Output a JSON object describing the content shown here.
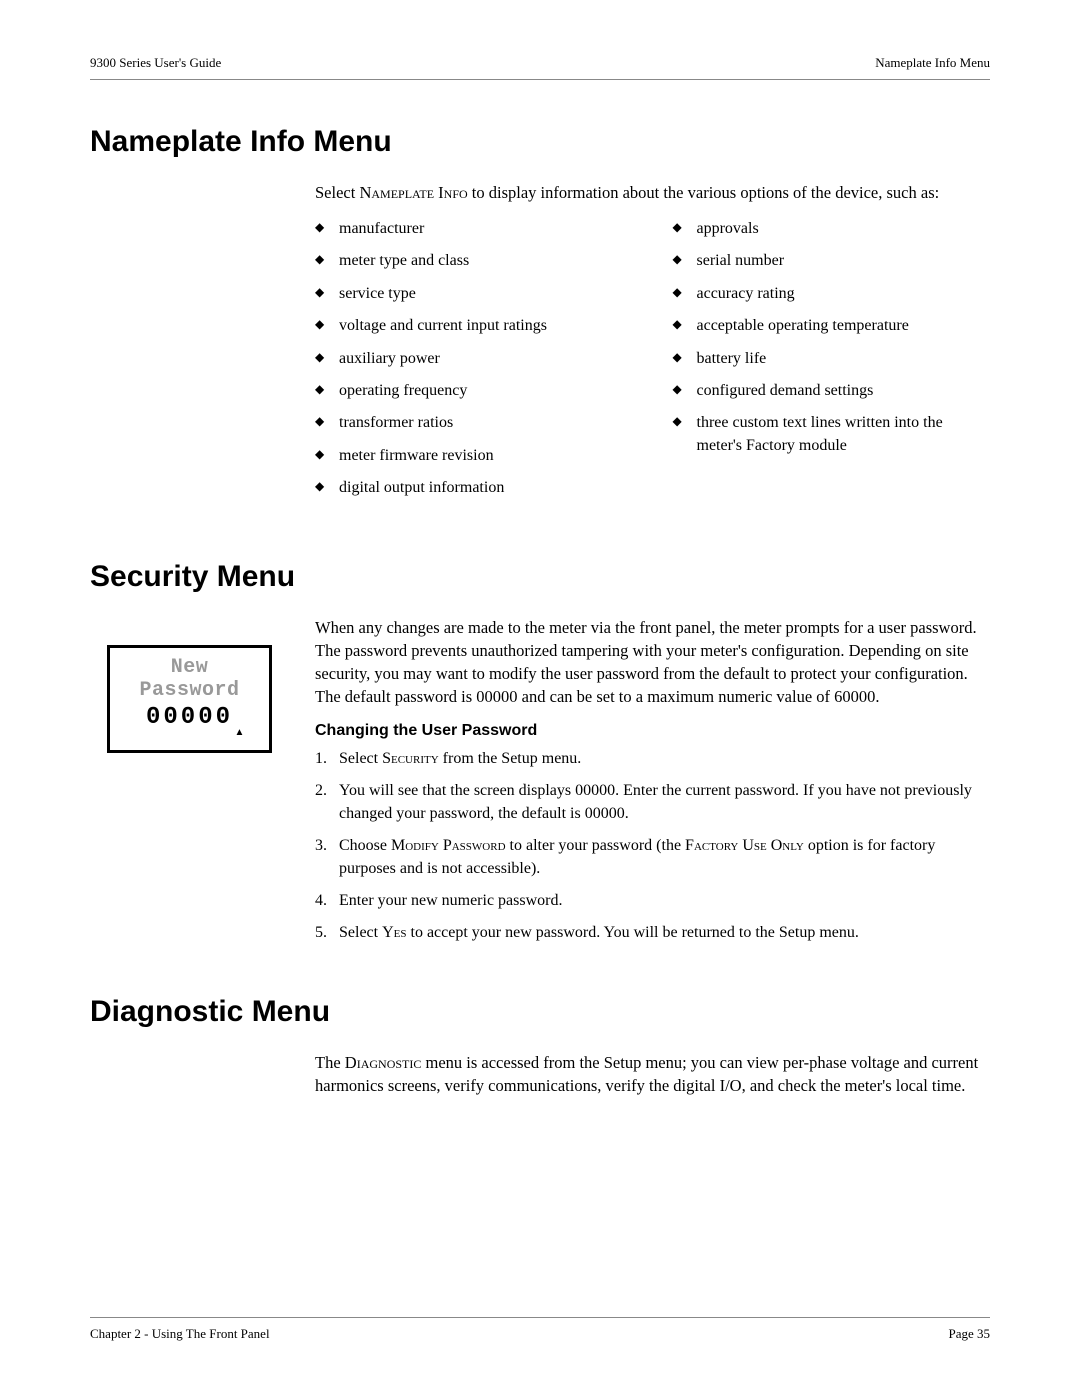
{
  "header": {
    "left": "9300 Series User's Guide",
    "right": "Nameplate Info Menu"
  },
  "footer": {
    "left": "Chapter 2 - Using The Front Panel",
    "right": "Page 35"
  },
  "s1": {
    "heading": "Nameplate Info Menu",
    "intro_pre": "Select ",
    "intro_sc": "Nameplate Info",
    "intro_post": " to display information about the various options of the device, such as:",
    "col1": [
      "manufacturer",
      "meter type and class",
      "service type",
      "voltage and current input ratings",
      "auxiliary power",
      "operating frequency",
      "transformer ratios",
      "meter firmware revision",
      "digital output information"
    ],
    "col2": [
      "approvals",
      "serial number",
      "accuracy rating",
      "acceptable operating temperature",
      "battery life",
      "configured demand settings",
      "three custom text lines written into the meter's Factory module"
    ]
  },
  "s2": {
    "heading": "Security Menu",
    "para": "When any changes are made to the meter via the front panel, the meter prompts for a user password. The password prevents unauthorized tampering with your meter's configuration. Depending on site security, you may want to modify the user password from the default to protect your configuration. The default password is 00000 and can be set to a maximum numeric value of 60000.",
    "sub_heading": "Changing the User Password",
    "step1_pre": "Select ",
    "step1_sc": "Security",
    "step1_post": " from the Setup menu.",
    "step2": "You will see that the screen displays 00000. Enter the current password. If you have not previously changed your password, the default is 00000.",
    "step3_pre": "Choose ",
    "step3_sc1": "Modify Password",
    "step3_mid": " to alter your password (the ",
    "step3_sc2": "Factory Use Only",
    "step3_post": " option is for factory purposes and is not accessible).",
    "step4": "Enter your new numeric password.",
    "step5_pre": "Select ",
    "step5_sc": "Yes",
    "step5_post": " to accept your new password. You will be returned to the Setup menu.",
    "lcd_line1": "New Password",
    "lcd_line2": "00000"
  },
  "s3": {
    "heading": "Diagnostic Menu",
    "para_pre": "The ",
    "para_sc": "Diagnostic",
    "para_post": " menu is accessed from the Setup menu; you can view per-phase voltage and current harmonics screens, verify communications, verify the digital I/O, and check the meter's local time."
  }
}
